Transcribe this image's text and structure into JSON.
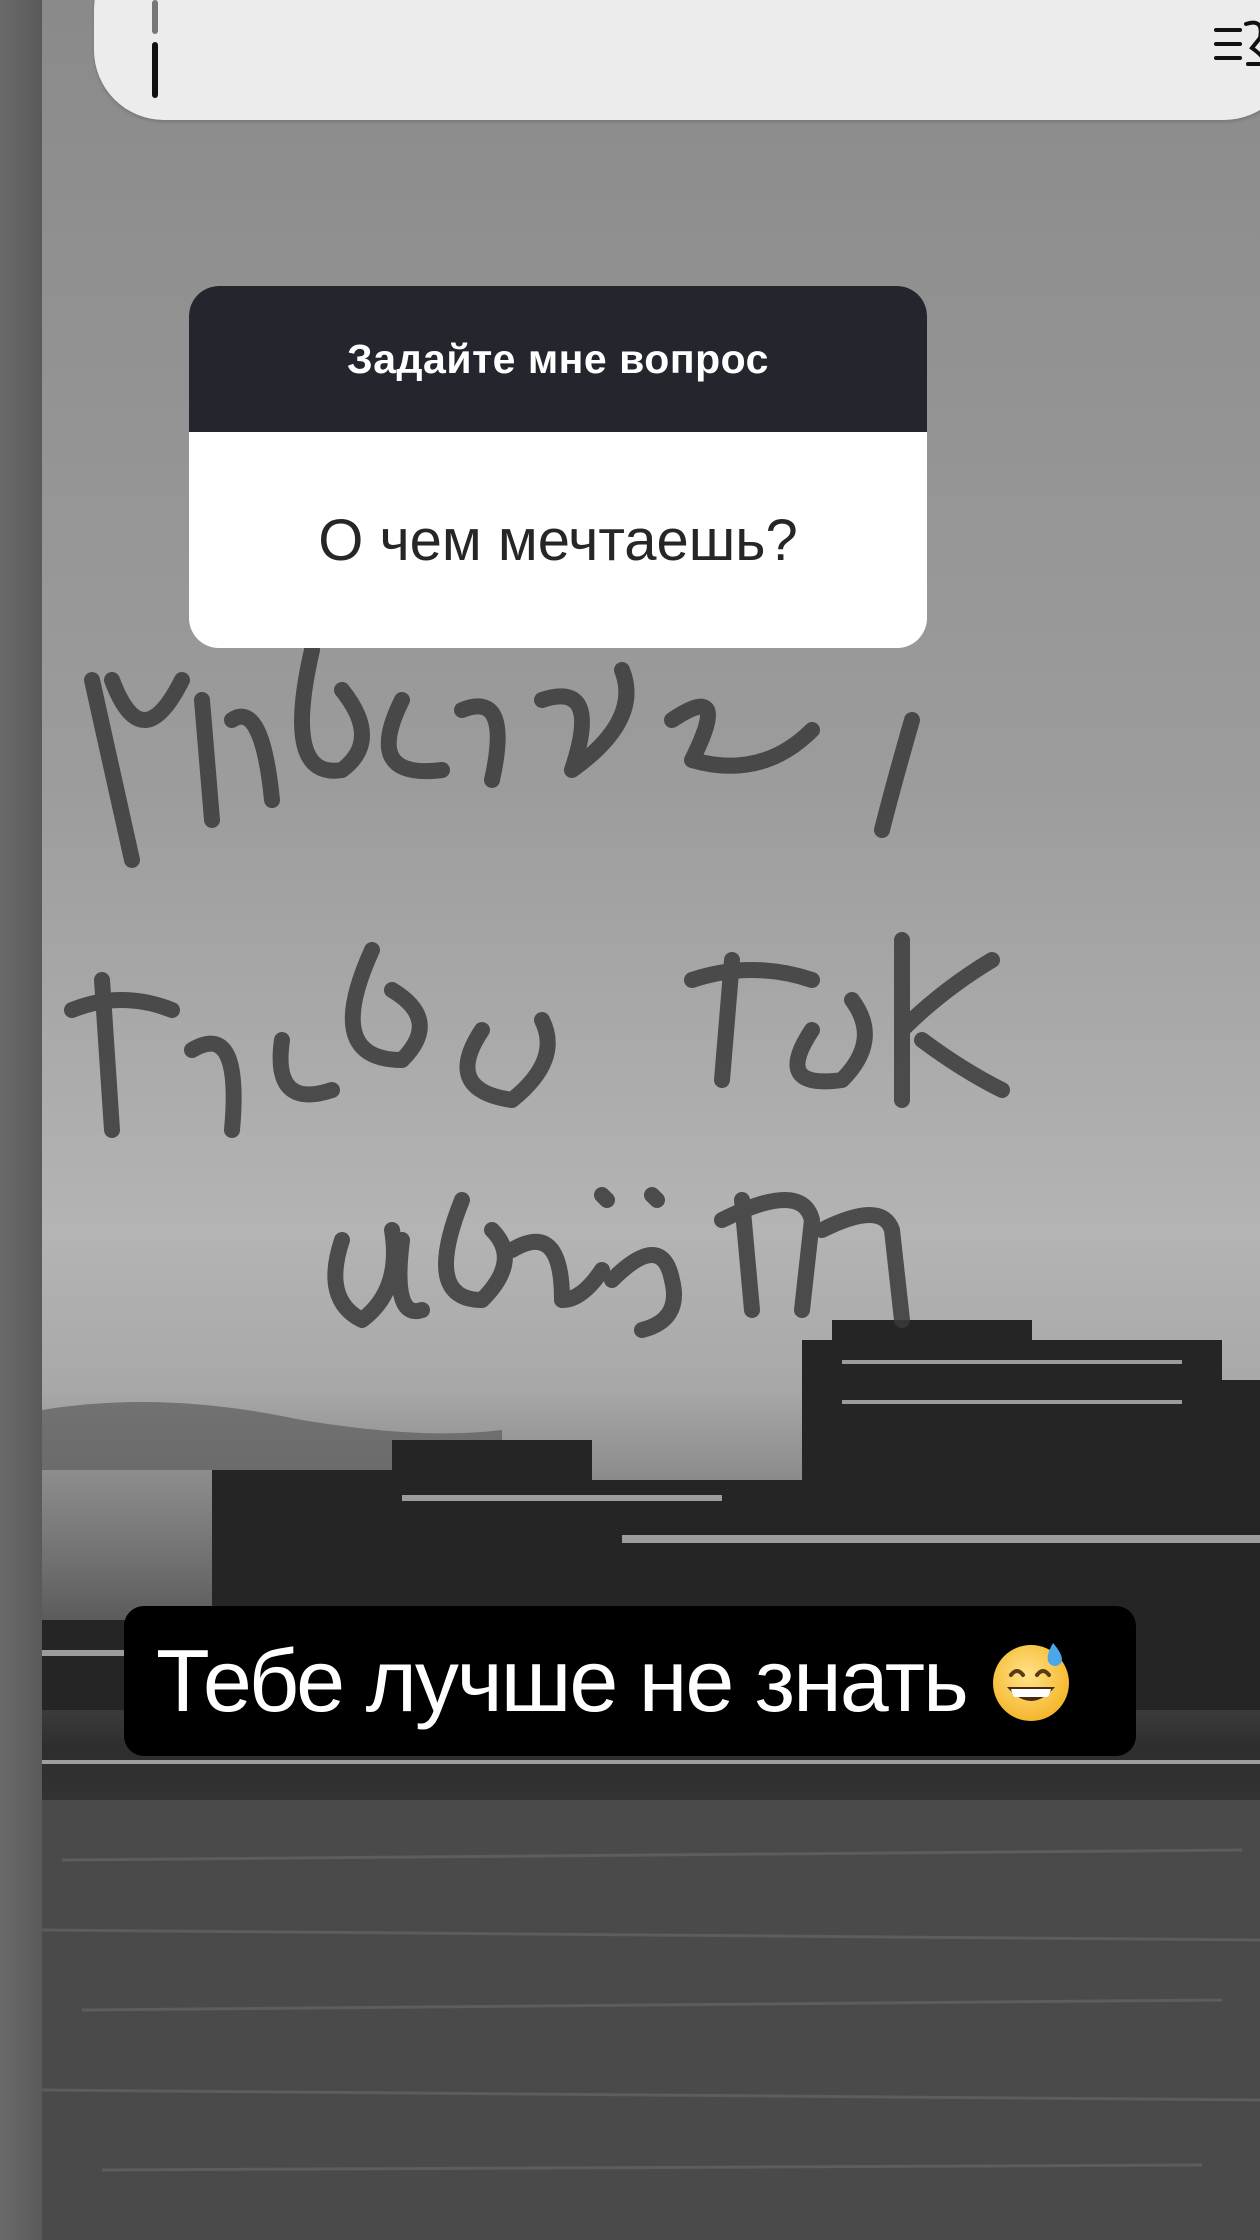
{
  "text_editor": {
    "align_icon": "text-align-icon"
  },
  "question_sticker": {
    "header": "Задайте мне вопрос",
    "question": "О чем мечтаешь?"
  },
  "reply": {
    "text": "Тебе лучше не знать",
    "emoji": "grinning-face-with-sweat-icon"
  },
  "colors": {
    "sticker_header_bg": "#23262d",
    "sticker_body_bg": "#ffffff",
    "reply_bg": "#000000",
    "reply_text": "#ffffff"
  }
}
